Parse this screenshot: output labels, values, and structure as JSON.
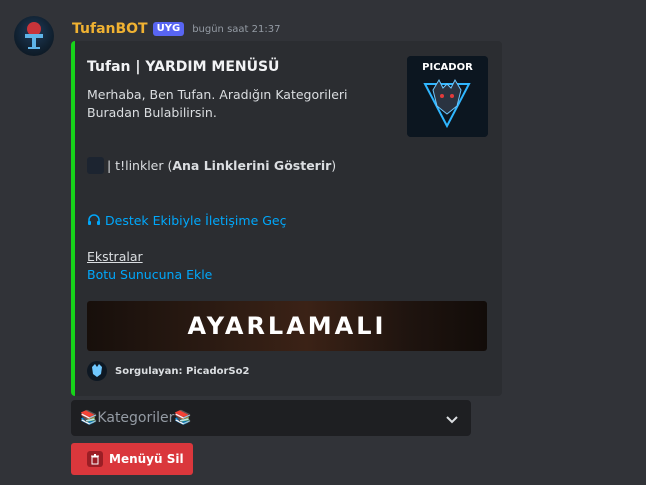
{
  "message": {
    "username": "TufanBOT",
    "app_tag": "UYG",
    "timestamp": "bugün saat 21:37"
  },
  "embed": {
    "accent_color": "#17d31a",
    "title": "Tufan | YARDIM MENÜSÜ",
    "description": "Merhaba, Ben Tufan. Aradığın Kategorileri Buradan Bulabilirsin.",
    "thumbnail_text": "PICADOR",
    "command_line": {
      "prefix": "| t!linkler (",
      "bold": "Ana Linklerini Gösterir",
      "suffix": ")"
    },
    "support_link": "Destek Ekibiyle İletişime Geç",
    "extras_label": "Ekstralar",
    "add_bot_link": "Botu Sunucuna Ekle",
    "banner_text": "AYARLAMALI",
    "footer": "Sorgulayan: PicadorSo2"
  },
  "select_menu": {
    "placeholder": "📚Kategoriler📚"
  },
  "buttons": {
    "delete_menu": "Menüyü Sil"
  },
  "colors": {
    "background": "#313338",
    "embed_bg": "#2b2d31",
    "username": "#f0b232",
    "link": "#00a8fc",
    "danger": "#da373c",
    "app_tag": "#5865f2"
  },
  "icons": {
    "support": "headset-icon",
    "chevron": "chevron-down-icon",
    "trash": "trash-icon"
  }
}
